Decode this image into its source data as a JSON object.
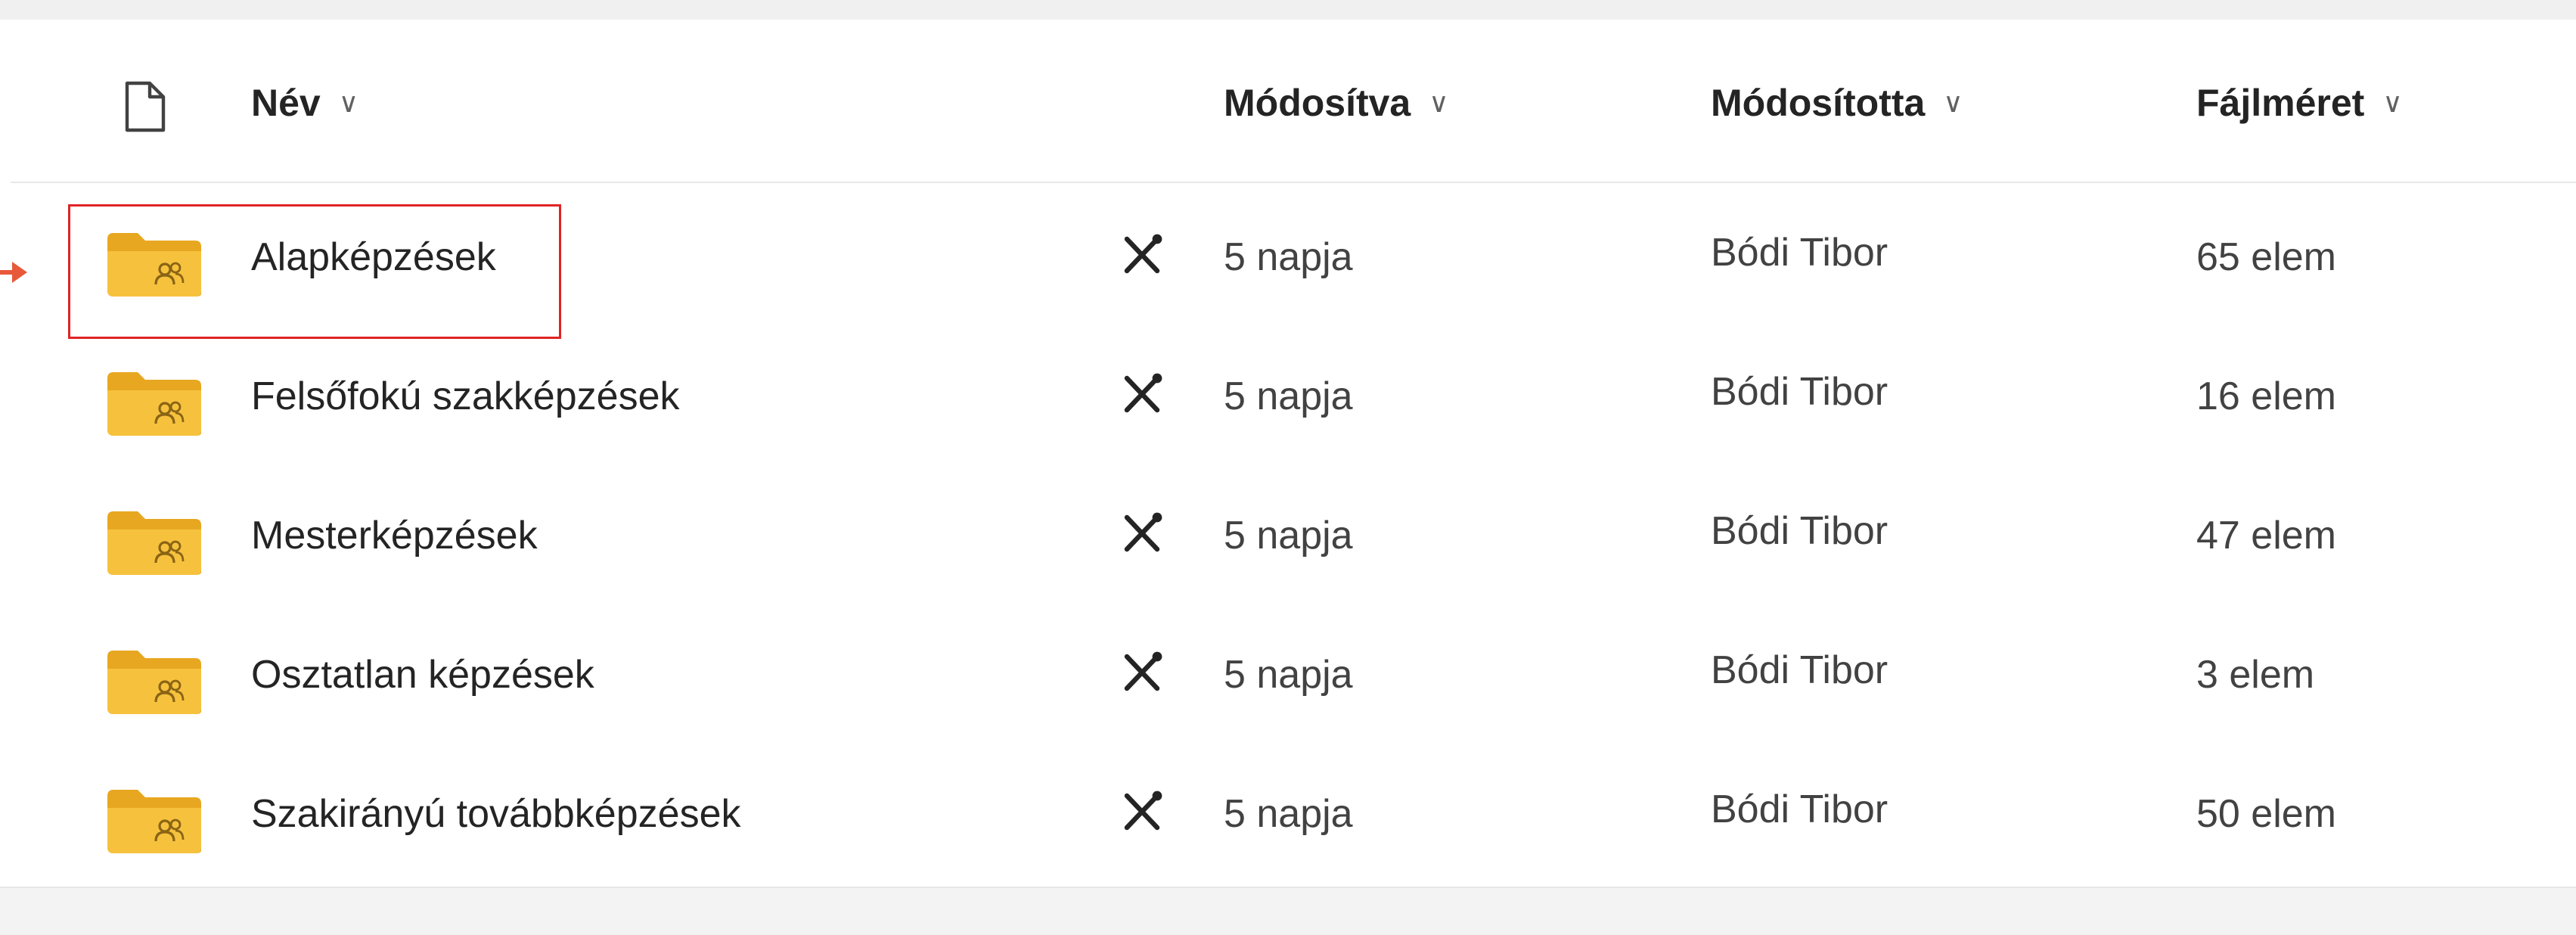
{
  "columns": {
    "name": "Név",
    "modified": "Módosítva",
    "modified_by": "Módosította",
    "file_size": "Fájlméret"
  },
  "icons": {
    "file_type": "document-icon",
    "sort": "chevron-down-icon",
    "folder": "shared-folder-icon",
    "sync": "tools-icon"
  },
  "colors": {
    "folder": "#f6c23e",
    "highlight": "#e02424",
    "pointer": "#e8593b"
  },
  "rows": [
    {
      "name": "Alapképzések",
      "modified": "5 napja",
      "modified_by": "Bódi Tibor",
      "size": "65 elem"
    },
    {
      "name": "Felsőfokú szakképzések",
      "modified": "5 napja",
      "modified_by": "Bódi Tibor",
      "size": "16 elem"
    },
    {
      "name": "Mesterképzések",
      "modified": "5 napja",
      "modified_by": "Bódi Tibor",
      "size": "47 elem"
    },
    {
      "name": "Osztatlan képzések",
      "modified": "5 napja",
      "modified_by": "Bódi Tibor",
      "size": "3 elem"
    },
    {
      "name": "Szakirányú továbbképzések",
      "modified": "5 napja",
      "modified_by": "Bódi Tibor",
      "size": "50 elem"
    }
  ]
}
